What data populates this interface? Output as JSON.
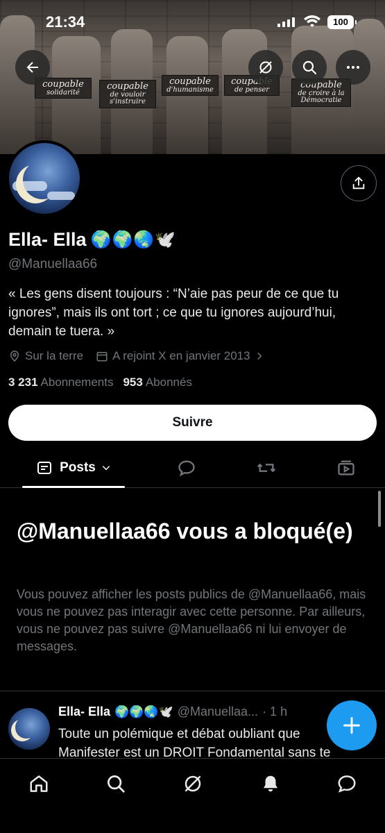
{
  "status_bar": {
    "time": "21:34",
    "battery": "100"
  },
  "profile": {
    "display_name": "Ella- Ella",
    "name_emojis": "🌍🌍🌏🕊️",
    "handle": "@Manuellaa66",
    "bio": "« Les gens disent toujours : “N’aie pas peur de ce que tu ignores”, mais ils ont tort ; ce que tu ignores aujourd’hui, demain te tuera. »",
    "location": "Sur la terre",
    "joined": "A rejoint X en janvier 2013",
    "following_count": "3 231",
    "following_label": "Abonnements",
    "followers_count": "953",
    "followers_label": "Abonnés",
    "follow_button": "Suivre"
  },
  "banner_signs": [
    {
      "line1": "coupable",
      "line2": "solidarité"
    },
    {
      "line1": "coupable",
      "line2": "de vouloir s'instruire"
    },
    {
      "line1": "coupable",
      "line2": "d'humanisme"
    },
    {
      "line1": "coupable",
      "line2": "de penser"
    },
    {
      "line1": "coupable",
      "line2": "de croire à la Démocratie"
    }
  ],
  "tabs": {
    "posts_label": "Posts"
  },
  "blocked": {
    "title": "@Manuellaa66 vous a bloqué(e)",
    "text": "Vous pouvez afficher les posts publics de @Manuellaa66, mais vous ne pouvez pas interagir avec cette personne. Par ailleurs, vous ne pouvez pas suivre @Manuellaa66 ni lui envoyer de messages."
  },
  "post": {
    "name": "Ella- Ella",
    "emojis": "🌍🌍🌏🕊️",
    "handle": "@Manuellaa...",
    "time": "· 1 h",
    "text": "Toute un polémique et débat oubliant que Manifester est un DROIT Fondamental sans te"
  },
  "colors": {
    "accent": "#1d9bf0",
    "muted": "#71767b",
    "background": "#000000"
  }
}
